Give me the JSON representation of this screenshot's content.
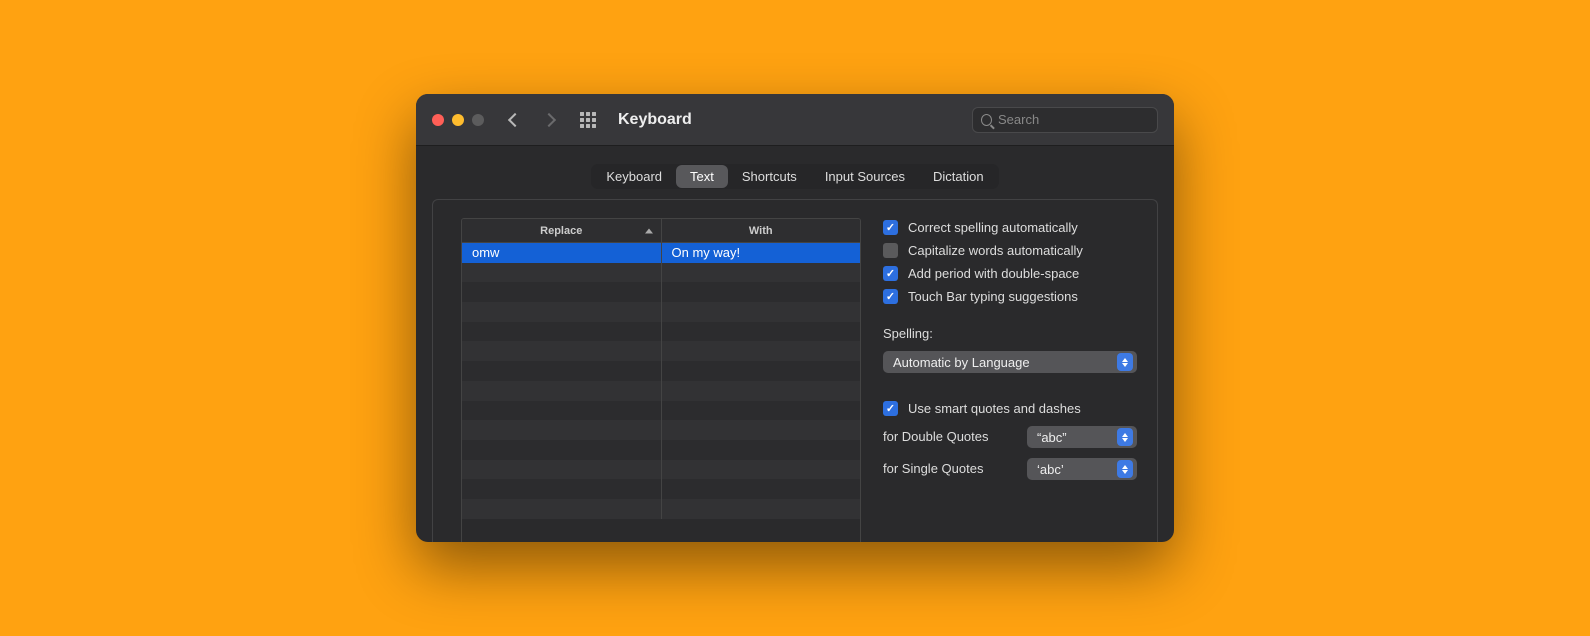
{
  "window": {
    "title": "Keyboard",
    "search_placeholder": "Search"
  },
  "tabs": {
    "items": [
      "Keyboard",
      "Text",
      "Shortcuts",
      "Input Sources",
      "Dictation"
    ],
    "active_index": 1
  },
  "table": {
    "columns": [
      "Replace",
      "With"
    ],
    "sort_column": 0,
    "rows": [
      {
        "replace": "omw",
        "with": "On my way!",
        "selected": true
      }
    ],
    "blank_rows": 13
  },
  "options": {
    "correct_spelling": {
      "label": "Correct spelling automatically",
      "checked": true
    },
    "capitalize": {
      "label": "Capitalize words automatically",
      "checked": false
    },
    "double_space": {
      "label": "Add period with double-space",
      "checked": true
    },
    "touchbar": {
      "label": "Touch Bar typing suggestions",
      "checked": true
    },
    "spelling_label": "Spelling:",
    "spelling_value": "Automatic by Language",
    "smart_quotes": {
      "label": "Use smart quotes and dashes",
      "checked": true
    },
    "double_quotes_label": "for Double Quotes",
    "double_quotes_value": "“abc”",
    "single_quotes_label": "for Single Quotes",
    "single_quotes_value": "‘abc’"
  }
}
